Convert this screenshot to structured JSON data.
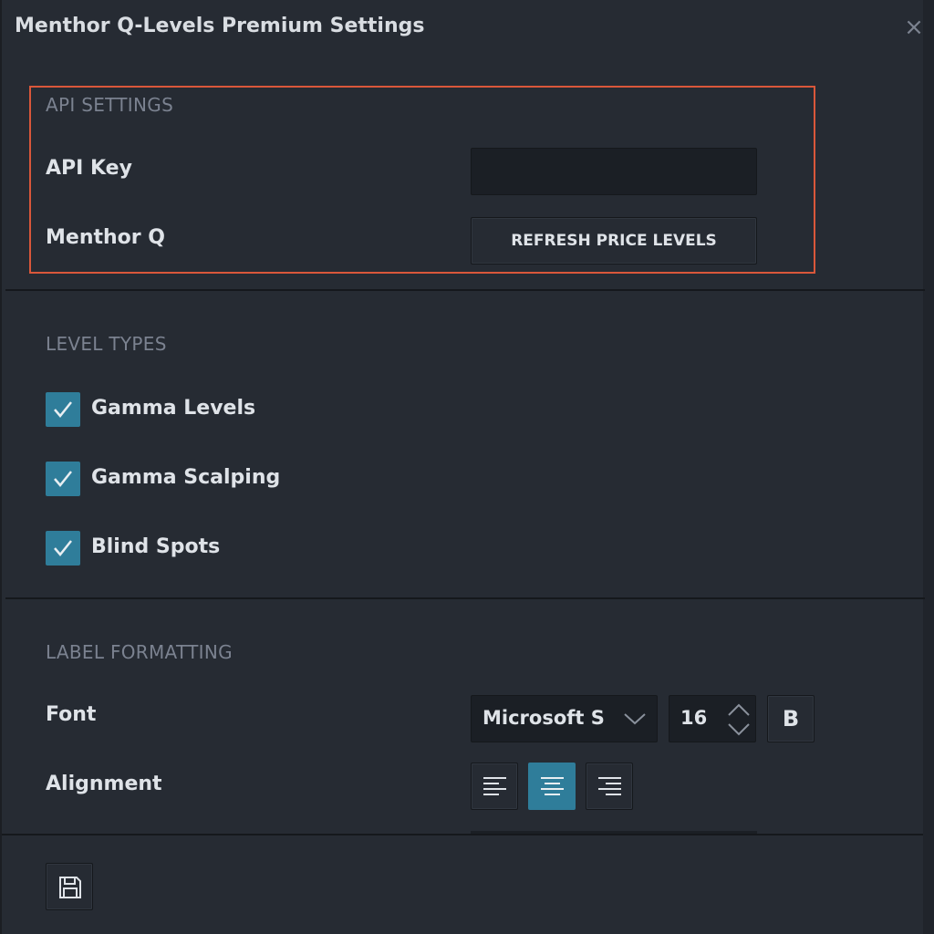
{
  "window": {
    "title": "Menthor Q-Levels Premium Settings",
    "close_symbol": "×"
  },
  "api_settings": {
    "section_title": "API SETTINGS",
    "api_key_label": "API Key",
    "api_key_value": "",
    "menthor_label": "Menthor Q",
    "refresh_button_label": "REFRESH PRICE LEVELS"
  },
  "level_types": {
    "section_title": "LEVEL TYPES",
    "items": [
      {
        "label": "Gamma Levels",
        "checked": true
      },
      {
        "label": "Gamma Scalping",
        "checked": true
      },
      {
        "label": "Blind Spots",
        "checked": true
      }
    ]
  },
  "label_formatting": {
    "section_title": "LABEL FORMATTING",
    "font_label": "Font",
    "font_value": "Microsoft S",
    "size_value": "16",
    "bold_label": "B",
    "alignment_label": "Alignment",
    "alignment_selected": "center"
  },
  "icons": {
    "close": "close-icon",
    "check": "checkmark-icon",
    "dropdown": "chevron-down-icon",
    "stepper": "up-down-arrows-icon",
    "align_left": "align-left-icon",
    "align_center": "align-center-icon",
    "align_right": "align-right-icon",
    "save": "save-icon"
  },
  "colors": {
    "accent": "#2f7d9a",
    "highlight_border": "#d9573a",
    "background": "#262b33"
  }
}
